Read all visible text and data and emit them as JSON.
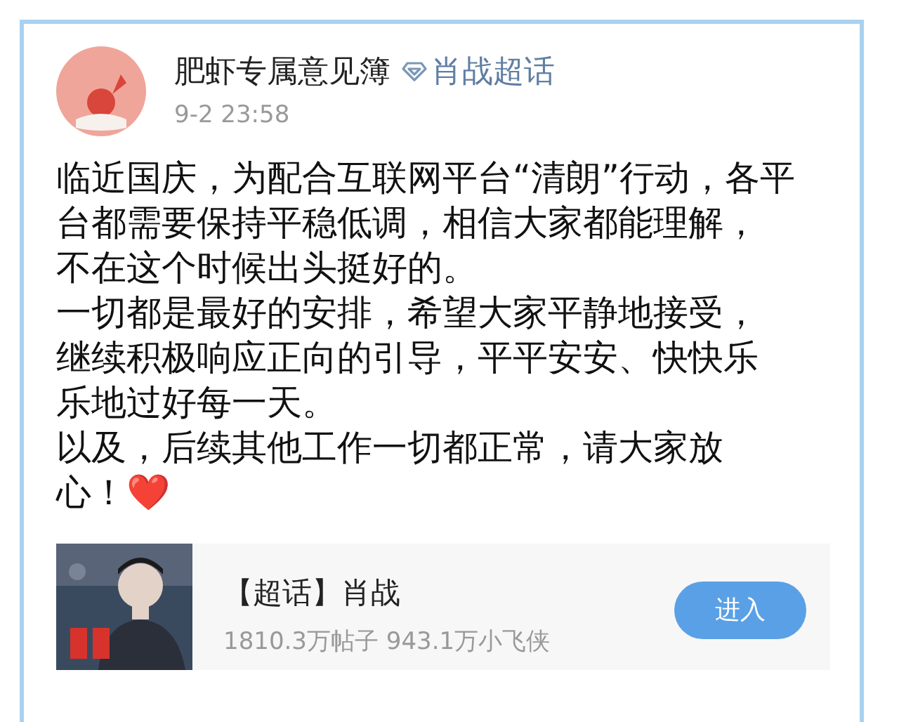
{
  "post": {
    "author": "肥虾专属意见簿",
    "topic": "肖战超话",
    "time": "9-2 23:58",
    "lines": [
      "临近国庆，为配合互联网平台“清朗”行动，各平",
      "台都需要保持平稳低调，相信大家都能理解，",
      "不在这个时候出头挺好的。",
      "一切都是最好的安排，希望大家平静地接受，",
      "继续积极响应正向的引导，平平安安、快快乐",
      "乐地过好每一天。",
      "以及，后续其他工作一切都正常，请大家放",
      "心！❤️"
    ]
  },
  "topic_card": {
    "title": "【超话】肖战",
    "stats": "1810.3万帖子 943.1万小飞侠",
    "button": "进入"
  }
}
